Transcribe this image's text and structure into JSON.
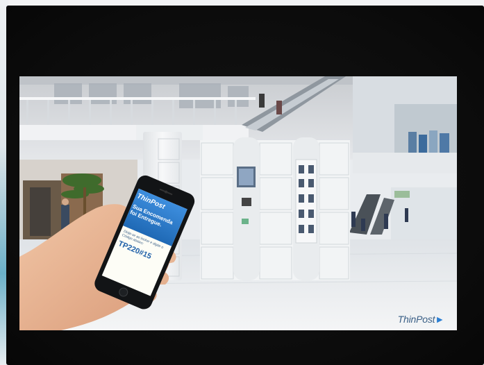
{
  "colors": {
    "bezel": "#0d0d0d",
    "mall_floor": "#e9edf0",
    "locker": "#eef0f2",
    "phone_screen_top": "#2f7fd0",
    "phone_screen_body": "#fdfdf6",
    "brand_blue": "#2b7fd3"
  },
  "phone": {
    "brand": "ThinPost",
    "headline": "Sua Encomenda foi Entregue.",
    "subtext": "Dirija-se ao locker e digite o Código abaixo:",
    "code": "TP220#15"
  },
  "footer_brand": "ThinPost"
}
